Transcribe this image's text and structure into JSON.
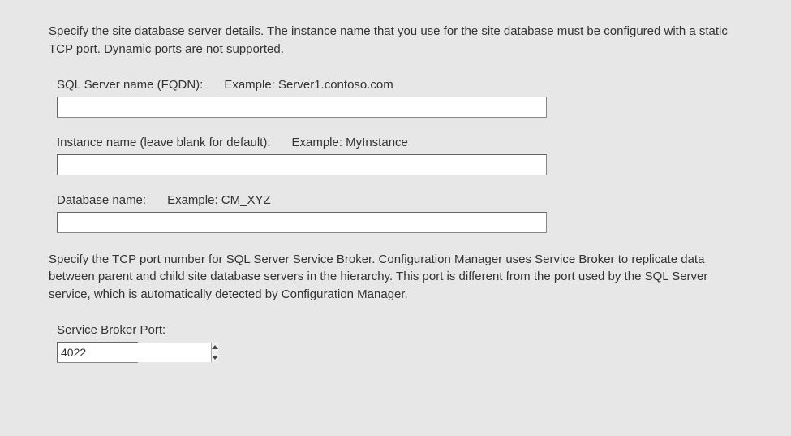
{
  "description_top": "Specify the site database server details. The instance name that you use for the site database must be configured with a static TCP port. Dynamic ports are not supported.",
  "fields": {
    "sql_server": {
      "label": "SQL Server name (FQDN):",
      "example": "Example: Server1.contoso.com",
      "value": ""
    },
    "instance_name": {
      "label": "Instance name (leave blank for default):",
      "example": "Example: MyInstance",
      "value": ""
    },
    "database_name": {
      "label": "Database name:",
      "example": "Example: CM_XYZ",
      "value": ""
    }
  },
  "description_broker": "Specify the TCP port number for SQL Server Service Broker. Configuration Manager uses Service Broker to replicate data between parent and child site database servers in the hierarchy. This port is different from the port used by the SQL Server service, which is automatically detected by Configuration Manager.",
  "service_broker": {
    "label": "Service Broker Port:",
    "value": "4022"
  }
}
